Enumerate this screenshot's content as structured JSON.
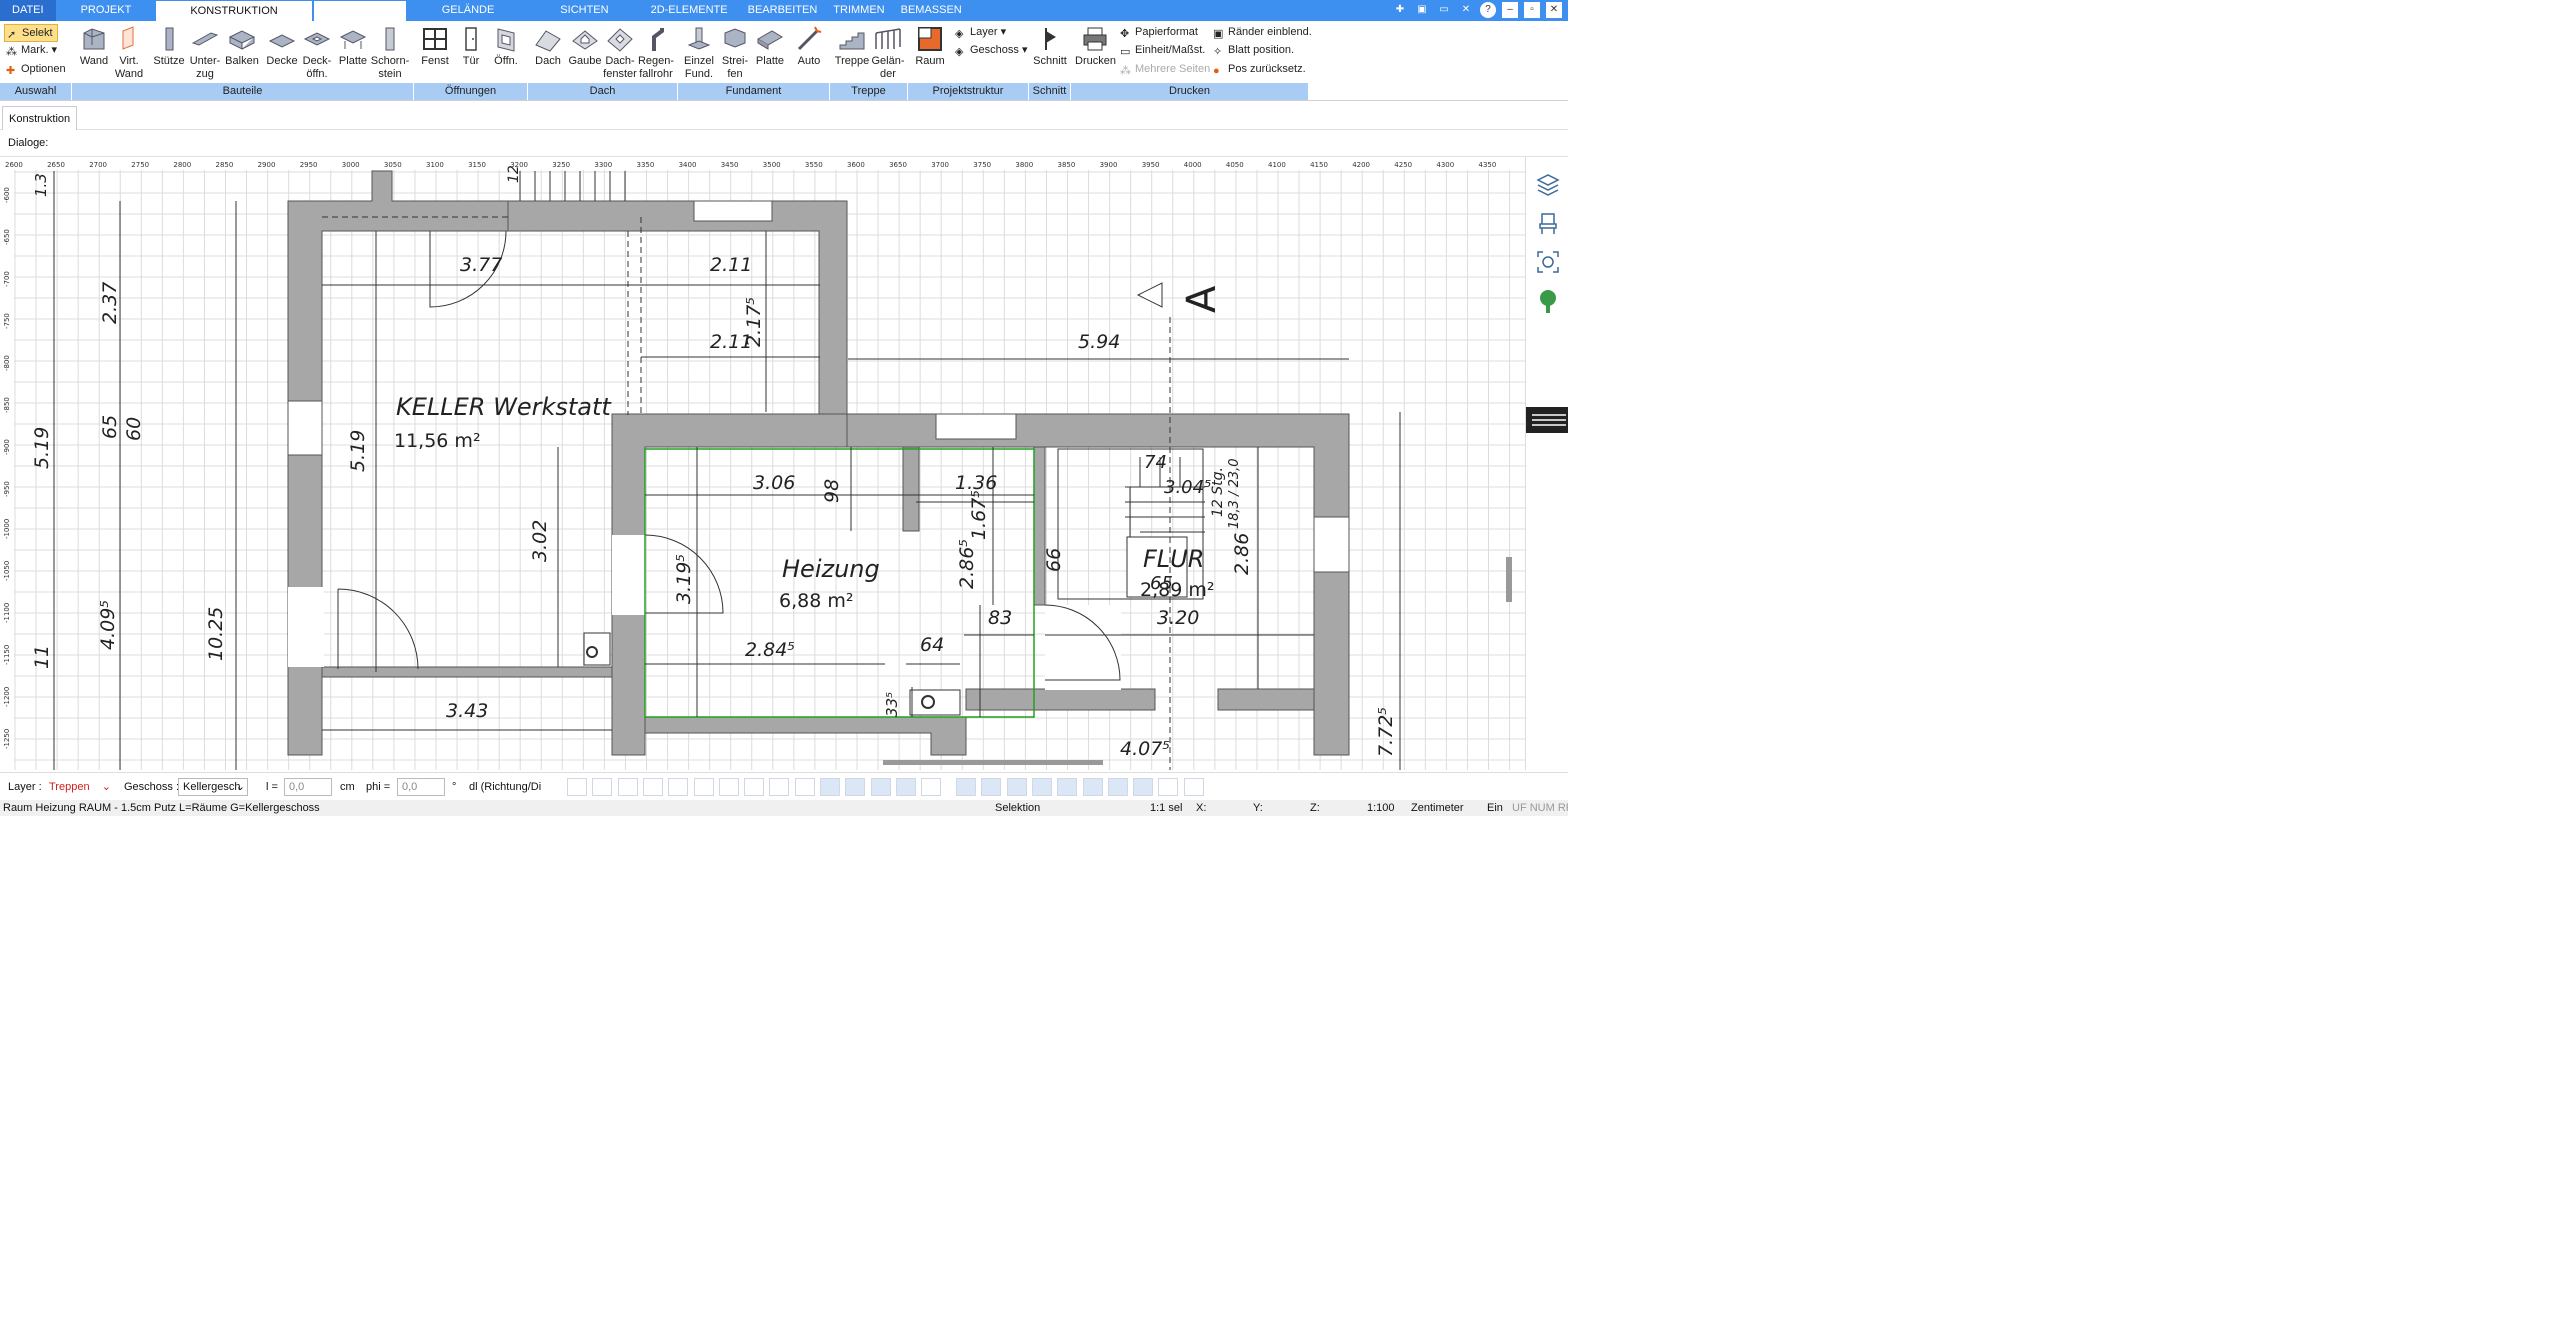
{
  "tabs": [
    {
      "label": "DATEI"
    },
    {
      "label": "PROJEKT"
    },
    {
      "label": "KONSTRUKTION"
    },
    {
      "label": ""
    },
    {
      "label": "GELÄNDE"
    },
    {
      "label": "SICHTEN"
    },
    {
      "label": "2D-ELEMENTE"
    },
    {
      "label": "BEARBEITEN"
    },
    {
      "label": "TRIMMEN"
    },
    {
      "label": "BEMASSEN"
    }
  ],
  "ribbon": {
    "auswahl": {
      "selekt": "Selekt",
      "mark": "Mark.",
      "optionen": "Optionen"
    },
    "buttons": {
      "wand": "Wand",
      "virt_wand": "Virt.\nWand",
      "stuetze": "Stütze",
      "unterzug": "Unter-\nzug",
      "balken": "Balken",
      "decke": "Decke",
      "deckoeffn": "Deck-\nöffn.",
      "platte": "Platte",
      "schornstein": "Schorn-\nstein",
      "fenst": "Fenst",
      "tuer": "Tür",
      "oeffn": "Öffn.",
      "dach": "Dach",
      "gaube": "Gaube",
      "dachfenster": "Dach-\nfenster",
      "regenfallrohr": "Regen-\nfallrohr",
      "einzelfund": "Einzel\nFund.",
      "streifen": "Strei-\nfen",
      "platte2": "Platte",
      "auto": "Auto",
      "treppe": "Treppe",
      "gelaender": "Gelän-\nder",
      "raum": "Raum",
      "schnitt": "Schnitt",
      "drucken": "Drucken"
    },
    "projekt": {
      "layer": "Layer",
      "geschoss": "Geschoss"
    },
    "drucken_opts": {
      "papierformat": "Papierformat",
      "einheit": "Einheit/Maßst.",
      "mehrere": "Mehrere Seiten",
      "raender": "Ränder einblend.",
      "blatt": "Blatt position.",
      "pos": "Pos zurücksetz."
    },
    "groups": {
      "auswahl": "Auswahl",
      "bauteile": "Bauteile",
      "oeffnungen": "Öffnungen",
      "dach": "Dach",
      "fundament": "Fundament",
      "treppe": "Treppe",
      "projektstruktur": "Projektstruktur",
      "schnitt": "Schnitt",
      "drucken": "Drucken"
    }
  },
  "konstruktion_tab": "Konstruktion",
  "dialoge_label": "Dialoge:",
  "ruler": {
    "top": [
      "2600",
      "2650",
      "2700",
      "2750",
      "2800",
      "2850",
      "2900",
      "2950",
      "3000",
      "3050",
      "3100",
      "3150",
      "3200",
      "3250",
      "3300",
      "3350",
      "3400",
      "3450",
      "3500",
      "3550",
      "3600",
      "3650",
      "3700",
      "3750",
      "3800",
      "3850",
      "3900",
      "3950",
      "4000",
      "4050",
      "4100",
      "4150",
      "4200",
      "4250",
      "4300",
      "4350"
    ],
    "left": [
      "-600",
      "-650",
      "-700",
      "-750",
      "-800",
      "-850",
      "-900",
      "-950",
      "-1000",
      "-1050",
      "-1100",
      "-1150",
      "-1200",
      "-1250"
    ]
  },
  "plan": {
    "rooms": {
      "keller_name": "KELLER Werkstatt",
      "keller_area": "11,56 m²",
      "heizung_name": "Heizung",
      "heizung_area": "6,88 m²",
      "flur_name": "FLUR",
      "flur_area": "2,89 m²"
    },
    "dims": {
      "d377": "3.77",
      "d211a": "2.11",
      "d211b": "2.11",
      "d2175": "2.17⁵",
      "d594": "5.94",
      "d237": "2.37",
      "d65": "65",
      "d60": "60",
      "d519a": "5.19",
      "d519b": "5.19",
      "d306": "3.06",
      "d98": "98",
      "d136": "1.36",
      "d1675": "1.67⁵",
      "d2865": "2.86⁵",
      "d302": "3.02",
      "d3195": "3.19⁵",
      "d2845": "2.84⁵",
      "d64": "64",
      "d83": "83",
      "d4095": "4.09⁵",
      "d1025": "10.25",
      "d11": "11",
      "d343": "3.43",
      "d335": "33⁵",
      "d74": "74",
      "d3045": "3.04⁵",
      "d12stg": "12 Stg.",
      "d183": "18,3 / 23,0",
      "d66": "66",
      "d65b": "65",
      "d286": "2.86",
      "d320": "3.20",
      "d4075": "4.07⁵",
      "d7725": "7.72⁵",
      "d13": "1.3",
      "d12": "12"
    },
    "section_label": "A"
  },
  "optbar": {
    "layer_label": "Layer :",
    "layer_value": "Treppen",
    "geschoss_label": "Geschoss :",
    "geschoss_value": "Kellergesch",
    "l_label": "l =",
    "l_value": "0,0",
    "cm": "cm",
    "phi_label": "phi =",
    "phi_value": "0,0",
    "deg": "°",
    "dl_value": "dl (Richtung/Di"
  },
  "status": {
    "info": "Raum Heizung RAUM - 1.5cm Putz L=Räume G=Kellergeschoss",
    "mode": "Selektion",
    "sel": "1:1 sel",
    "x": "X:",
    "y": "Y:",
    "z": "Z:",
    "scale": "1:100",
    "unit": "Zentimeter",
    "ein": "Ein",
    "flags": "UF NUM RF"
  },
  "colors": {
    "accent": "#3d8ff0",
    "group": "#a9ccf5",
    "wall": "#a7a7a7",
    "room_outline": "#22a022",
    "layer_value": "#d02020"
  }
}
